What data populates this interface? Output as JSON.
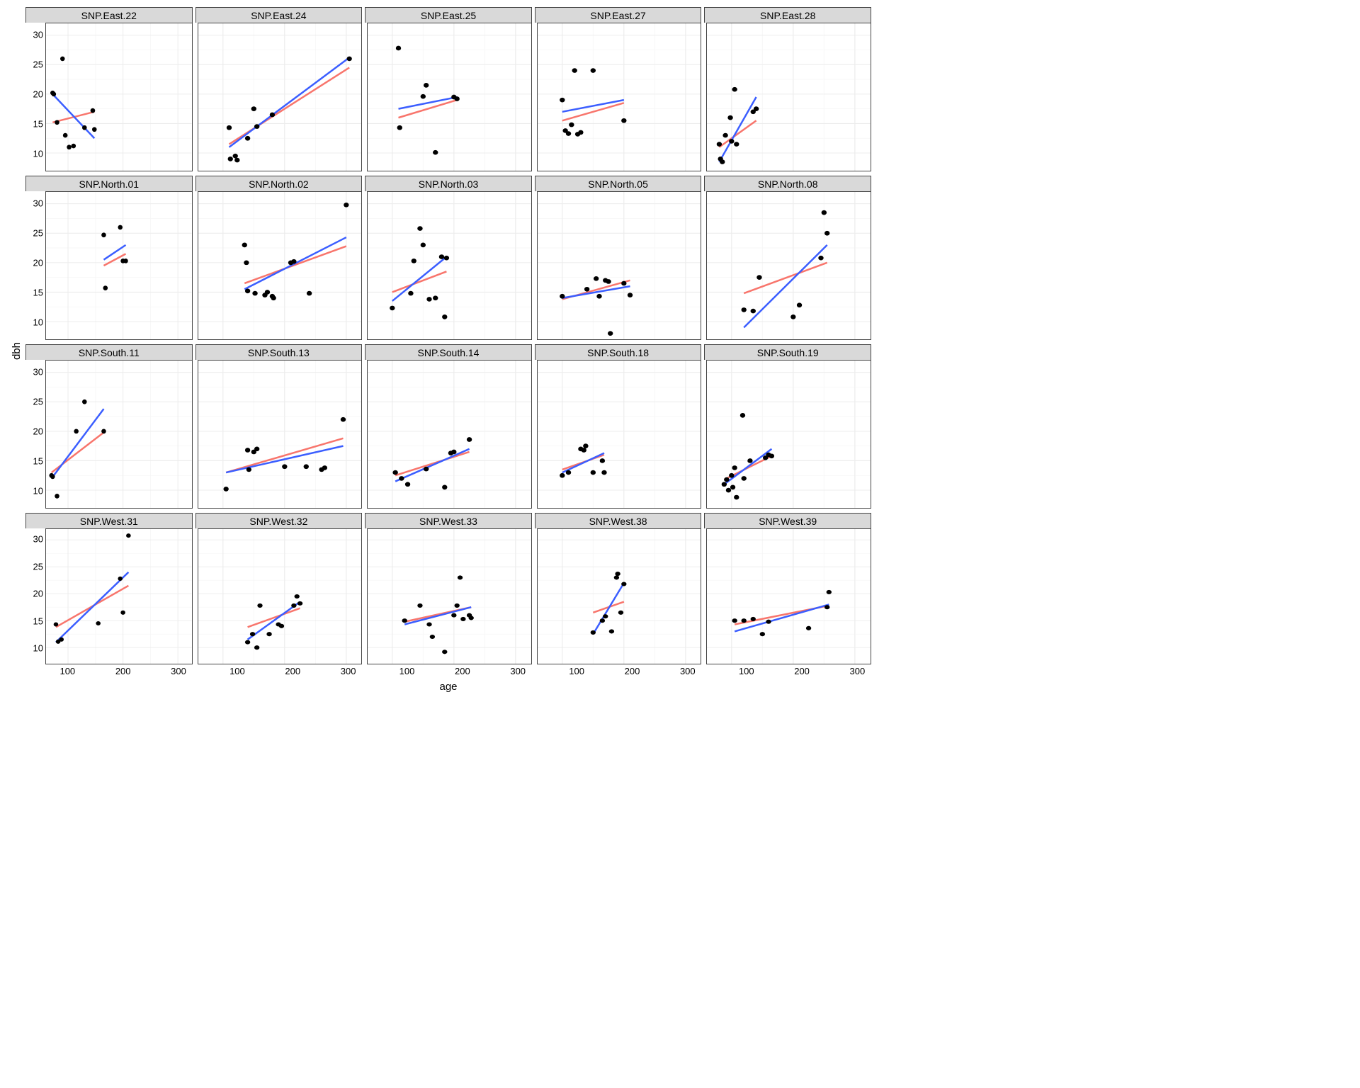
{
  "axis": {
    "x_label": "age",
    "y_label": "dbh"
  },
  "layout": {
    "rows": 4,
    "cols": 5
  },
  "shared": {
    "xlim": [
      60,
      325
    ],
    "ylim": [
      7,
      32
    ],
    "x_ticks": [
      100,
      200,
      300
    ],
    "y_ticks": [
      10,
      15,
      20,
      25,
      30
    ],
    "x_minor": [
      150,
      250
    ],
    "y_minor": [
      12.5,
      17.5,
      22.5,
      27.5
    ]
  },
  "chart_data": [
    {
      "title": "SNP.East.22",
      "type": "scatter",
      "points": [
        {
          "x": 72,
          "y": 20.2
        },
        {
          "x": 74,
          "y": 20.0
        },
        {
          "x": 80,
          "y": 15.2
        },
        {
          "x": 90,
          "y": 26.0
        },
        {
          "x": 95,
          "y": 13.0
        },
        {
          "x": 102,
          "y": 11.0
        },
        {
          "x": 110,
          "y": 11.2
        },
        {
          "x": 130,
          "y": 14.3
        },
        {
          "x": 145,
          "y": 17.2
        },
        {
          "x": 148,
          "y": 14.0
        }
      ],
      "red": {
        "x1": 72,
        "y1": 15.2,
        "x2": 148,
        "y2": 17.0
      },
      "blue": {
        "x1": 72,
        "y1": 20.0,
        "x2": 148,
        "y2": 12.5
      }
    },
    {
      "title": "SNP.East.24",
      "type": "scatter",
      "points": [
        {
          "x": 110,
          "y": 14.3
        },
        {
          "x": 112,
          "y": 9.0
        },
        {
          "x": 120,
          "y": 9.5
        },
        {
          "x": 123,
          "y": 8.8
        },
        {
          "x": 140,
          "y": 12.5
        },
        {
          "x": 150,
          "y": 17.5
        },
        {
          "x": 155,
          "y": 14.5
        },
        {
          "x": 180,
          "y": 16.5
        },
        {
          "x": 305,
          "y": 26.0
        }
      ],
      "red": {
        "x1": 110,
        "y1": 11.5,
        "x2": 305,
        "y2": 24.5
      },
      "blue": {
        "x1": 110,
        "y1": 11.0,
        "x2": 305,
        "y2": 26.2
      }
    },
    {
      "title": "SNP.East.25",
      "type": "scatter",
      "points": [
        {
          "x": 110,
          "y": 27.8
        },
        {
          "x": 112,
          "y": 14.3
        },
        {
          "x": 150,
          "y": 19.6
        },
        {
          "x": 155,
          "y": 21.5
        },
        {
          "x": 170,
          "y": 10.1
        },
        {
          "x": 200,
          "y": 19.5
        },
        {
          "x": 205,
          "y": 19.2
        }
      ],
      "red": {
        "x1": 110,
        "y1": 16.0,
        "x2": 205,
        "y2": 19.0
      },
      "blue": {
        "x1": 110,
        "y1": 17.5,
        "x2": 205,
        "y2": 19.5
      }
    },
    {
      "title": "SNP.East.27",
      "type": "scatter",
      "points": [
        {
          "x": 100,
          "y": 19.0
        },
        {
          "x": 105,
          "y": 13.8
        },
        {
          "x": 110,
          "y": 13.3
        },
        {
          "x": 115,
          "y": 14.8
        },
        {
          "x": 120,
          "y": 24.0
        },
        {
          "x": 125,
          "y": 13.2
        },
        {
          "x": 130,
          "y": 13.5
        },
        {
          "x": 150,
          "y": 24.0
        },
        {
          "x": 200,
          "y": 15.5
        }
      ],
      "red": {
        "x1": 100,
        "y1": 15.5,
        "x2": 200,
        "y2": 18.5
      },
      "blue": {
        "x1": 100,
        "y1": 17.0,
        "x2": 200,
        "y2": 19.0
      }
    },
    {
      "title": "SNP.East.28",
      "type": "scatter",
      "points": [
        {
          "x": 80,
          "y": 11.5
        },
        {
          "x": 82,
          "y": 9.0
        },
        {
          "x": 85,
          "y": 8.5
        },
        {
          "x": 90,
          "y": 13.0
        },
        {
          "x": 98,
          "y": 16.0
        },
        {
          "x": 100,
          "y": 12.0
        },
        {
          "x": 105,
          "y": 20.8
        },
        {
          "x": 108,
          "y": 11.5
        },
        {
          "x": 135,
          "y": 17.0
        },
        {
          "x": 140,
          "y": 17.5
        }
      ],
      "red": {
        "x1": 80,
        "y1": 11.0,
        "x2": 140,
        "y2": 15.5
      },
      "blue": {
        "x1": 80,
        "y1": 8.5,
        "x2": 140,
        "y2": 19.5
      }
    },
    {
      "title": "SNP.North.01",
      "type": "scatter",
      "points": [
        {
          "x": 165,
          "y": 24.7
        },
        {
          "x": 168,
          "y": 15.7
        },
        {
          "x": 195,
          "y": 26.0
        },
        {
          "x": 200,
          "y": 20.3
        },
        {
          "x": 205,
          "y": 20.3
        }
      ],
      "red": {
        "x1": 165,
        "y1": 19.5,
        "x2": 205,
        "y2": 21.5
      },
      "blue": {
        "x1": 165,
        "y1": 20.5,
        "x2": 205,
        "y2": 23.0
      }
    },
    {
      "title": "SNP.North.02",
      "type": "scatter",
      "points": [
        {
          "x": 135,
          "y": 23.0
        },
        {
          "x": 138,
          "y": 20.0
        },
        {
          "x": 140,
          "y": 15.2
        },
        {
          "x": 152,
          "y": 14.8
        },
        {
          "x": 168,
          "y": 14.5
        },
        {
          "x": 172,
          "y": 15.0
        },
        {
          "x": 180,
          "y": 14.3
        },
        {
          "x": 182,
          "y": 14.0
        },
        {
          "x": 210,
          "y": 20.0
        },
        {
          "x": 215,
          "y": 20.2
        },
        {
          "x": 240,
          "y": 14.8
        },
        {
          "x": 300,
          "y": 29.8
        }
      ],
      "red": {
        "x1": 135,
        "y1": 16.5,
        "x2": 300,
        "y2": 22.8
      },
      "blue": {
        "x1": 135,
        "y1": 15.5,
        "x2": 300,
        "y2": 24.3
      }
    },
    {
      "title": "SNP.North.03",
      "type": "scatter",
      "points": [
        {
          "x": 100,
          "y": 12.3
        },
        {
          "x": 130,
          "y": 14.8
        },
        {
          "x": 135,
          "y": 20.3
        },
        {
          "x": 145,
          "y": 25.8
        },
        {
          "x": 150,
          "y": 23.0
        },
        {
          "x": 160,
          "y": 13.8
        },
        {
          "x": 170,
          "y": 14.0
        },
        {
          "x": 180,
          "y": 21.0
        },
        {
          "x": 185,
          "y": 10.8
        },
        {
          "x": 188,
          "y": 20.8
        }
      ],
      "red": {
        "x1": 100,
        "y1": 15.0,
        "x2": 188,
        "y2": 18.5
      },
      "blue": {
        "x1": 100,
        "y1": 13.5,
        "x2": 188,
        "y2": 21.0
      }
    },
    {
      "title": "SNP.North.05",
      "type": "scatter",
      "points": [
        {
          "x": 100,
          "y": 14.3
        },
        {
          "x": 140,
          "y": 15.5
        },
        {
          "x": 155,
          "y": 17.3
        },
        {
          "x": 160,
          "y": 14.3
        },
        {
          "x": 170,
          "y": 17.0
        },
        {
          "x": 175,
          "y": 16.8
        },
        {
          "x": 178,
          "y": 8.0
        },
        {
          "x": 200,
          "y": 16.5
        },
        {
          "x": 210,
          "y": 14.5
        }
      ],
      "red": {
        "x1": 100,
        "y1": 13.8,
        "x2": 210,
        "y2": 17.0
      },
      "blue": {
        "x1": 100,
        "y1": 14.0,
        "x2": 210,
        "y2": 16.0
      }
    },
    {
      "title": "SNP.North.08",
      "type": "scatter",
      "points": [
        {
          "x": 120,
          "y": 12.0
        },
        {
          "x": 135,
          "y": 11.8
        },
        {
          "x": 145,
          "y": 17.5
        },
        {
          "x": 200,
          "y": 10.8
        },
        {
          "x": 210,
          "y": 12.8
        },
        {
          "x": 245,
          "y": 20.8
        },
        {
          "x": 250,
          "y": 28.5
        },
        {
          "x": 255,
          "y": 25.0
        }
      ],
      "red": {
        "x1": 120,
        "y1": 14.8,
        "x2": 255,
        "y2": 20.0
      },
      "blue": {
        "x1": 120,
        "y1": 9.0,
        "x2": 255,
        "y2": 23.0
      }
    },
    {
      "title": "SNP.South.11",
      "type": "scatter",
      "points": [
        {
          "x": 70,
          "y": 12.5
        },
        {
          "x": 72,
          "y": 12.3
        },
        {
          "x": 80,
          "y": 9.0
        },
        {
          "x": 115,
          "y": 20.0
        },
        {
          "x": 130,
          "y": 25.0
        },
        {
          "x": 165,
          "y": 20.0
        }
      ],
      "red": {
        "x1": 70,
        "y1": 13.0,
        "x2": 165,
        "y2": 19.8
      },
      "blue": {
        "x1": 70,
        "y1": 12.0,
        "x2": 165,
        "y2": 23.8
      }
    },
    {
      "title": "SNP.South.13",
      "type": "scatter",
      "points": [
        {
          "x": 105,
          "y": 10.2
        },
        {
          "x": 140,
          "y": 16.8
        },
        {
          "x": 142,
          "y": 13.5
        },
        {
          "x": 150,
          "y": 16.5
        },
        {
          "x": 155,
          "y": 17.0
        },
        {
          "x": 200,
          "y": 14.0
        },
        {
          "x": 235,
          "y": 14.0
        },
        {
          "x": 260,
          "y": 13.5
        },
        {
          "x": 265,
          "y": 13.8
        },
        {
          "x": 295,
          "y": 22.0
        }
      ],
      "red": {
        "x1": 105,
        "y1": 13.0,
        "x2": 295,
        "y2": 18.8
      },
      "blue": {
        "x1": 105,
        "y1": 13.0,
        "x2": 295,
        "y2": 17.5
      }
    },
    {
      "title": "SNP.South.14",
      "type": "scatter",
      "points": [
        {
          "x": 105,
          "y": 13.0
        },
        {
          "x": 115,
          "y": 12.0
        },
        {
          "x": 125,
          "y": 11.0
        },
        {
          "x": 155,
          "y": 13.6
        },
        {
          "x": 185,
          "y": 10.5
        },
        {
          "x": 195,
          "y": 16.3
        },
        {
          "x": 200,
          "y": 16.5
        },
        {
          "x": 225,
          "y": 18.6
        }
      ],
      "red": {
        "x1": 105,
        "y1": 12.5,
        "x2": 225,
        "y2": 16.5
      },
      "blue": {
        "x1": 105,
        "y1": 11.5,
        "x2": 225,
        "y2": 17.0
      }
    },
    {
      "title": "SNP.South.18",
      "type": "scatter",
      "points": [
        {
          "x": 100,
          "y": 12.5
        },
        {
          "x": 110,
          "y": 13.0
        },
        {
          "x": 130,
          "y": 17.0
        },
        {
          "x": 135,
          "y": 16.8
        },
        {
          "x": 138,
          "y": 17.5
        },
        {
          "x": 150,
          "y": 13.0
        },
        {
          "x": 165,
          "y": 15.0
        },
        {
          "x": 168,
          "y": 13.0
        }
      ],
      "red": {
        "x1": 100,
        "y1": 13.5,
        "x2": 168,
        "y2": 16.0
      },
      "blue": {
        "x1": 100,
        "y1": 13.0,
        "x2": 168,
        "y2": 16.3
      }
    },
    {
      "title": "SNP.South.19",
      "type": "scatter",
      "points": [
        {
          "x": 88,
          "y": 11.0
        },
        {
          "x": 92,
          "y": 11.8
        },
        {
          "x": 95,
          "y": 10.0
        },
        {
          "x": 100,
          "y": 12.5
        },
        {
          "x": 102,
          "y": 10.5
        },
        {
          "x": 105,
          "y": 13.8
        },
        {
          "x": 108,
          "y": 8.8
        },
        {
          "x": 118,
          "y": 22.7
        },
        {
          "x": 120,
          "y": 12.0
        },
        {
          "x": 130,
          "y": 15.0
        },
        {
          "x": 155,
          "y": 15.5
        },
        {
          "x": 160,
          "y": 16.0
        },
        {
          "x": 165,
          "y": 15.8
        }
      ],
      "red": {
        "x1": 88,
        "y1": 11.8,
        "x2": 165,
        "y2": 15.8
      },
      "blue": {
        "x1": 88,
        "y1": 11.0,
        "x2": 165,
        "y2": 17.0
      }
    },
    {
      "title": "SNP.West.31",
      "type": "scatter",
      "points": [
        {
          "x": 78,
          "y": 14.3
        },
        {
          "x": 82,
          "y": 11.1
        },
        {
          "x": 88,
          "y": 11.5
        },
        {
          "x": 155,
          "y": 14.5
        },
        {
          "x": 195,
          "y": 22.8
        },
        {
          "x": 200,
          "y": 16.5
        },
        {
          "x": 210,
          "y": 30.8
        }
      ],
      "red": {
        "x1": 78,
        "y1": 13.8,
        "x2": 210,
        "y2": 21.5
      },
      "blue": {
        "x1": 78,
        "y1": 11.0,
        "x2": 210,
        "y2": 24.0
      }
    },
    {
      "title": "SNP.West.32",
      "type": "scatter",
      "points": [
        {
          "x": 140,
          "y": 11.0
        },
        {
          "x": 148,
          "y": 12.5
        },
        {
          "x": 155,
          "y": 10.0
        },
        {
          "x": 160,
          "y": 17.8
        },
        {
          "x": 175,
          "y": 12.5
        },
        {
          "x": 190,
          "y": 14.3
        },
        {
          "x": 195,
          "y": 14.0
        },
        {
          "x": 215,
          "y": 17.8
        },
        {
          "x": 220,
          "y": 19.5
        },
        {
          "x": 225,
          "y": 18.2
        }
      ],
      "red": {
        "x1": 140,
        "y1": 13.8,
        "x2": 225,
        "y2": 17.3
      },
      "blue": {
        "x1": 140,
        "y1": 11.5,
        "x2": 225,
        "y2": 18.5
      }
    },
    {
      "title": "SNP.West.33",
      "type": "scatter",
      "points": [
        {
          "x": 120,
          "y": 15.0
        },
        {
          "x": 145,
          "y": 17.8
        },
        {
          "x": 160,
          "y": 14.3
        },
        {
          "x": 165,
          "y": 12.0
        },
        {
          "x": 185,
          "y": 9.2
        },
        {
          "x": 200,
          "y": 16.0
        },
        {
          "x": 205,
          "y": 17.8
        },
        {
          "x": 210,
          "y": 23.0
        },
        {
          "x": 215,
          "y": 15.3
        },
        {
          "x": 225,
          "y": 16.0
        },
        {
          "x": 228,
          "y": 15.5
        }
      ],
      "red": {
        "x1": 120,
        "y1": 14.8,
        "x2": 228,
        "y2": 17.5
      },
      "blue": {
        "x1": 120,
        "y1": 14.3,
        "x2": 228,
        "y2": 17.5
      }
    },
    {
      "title": "SNP.West.38",
      "type": "scatter",
      "points": [
        {
          "x": 150,
          "y": 12.8
        },
        {
          "x": 165,
          "y": 15.0
        },
        {
          "x": 170,
          "y": 15.8
        },
        {
          "x": 180,
          "y": 13.0
        },
        {
          "x": 188,
          "y": 23.0
        },
        {
          "x": 190,
          "y": 23.7
        },
        {
          "x": 195,
          "y": 16.5
        },
        {
          "x": 200,
          "y": 21.8
        }
      ],
      "red": {
        "x1": 150,
        "y1": 16.5,
        "x2": 200,
        "y2": 18.5
      },
      "blue": {
        "x1": 150,
        "y1": 12.5,
        "x2": 200,
        "y2": 22.0
      }
    },
    {
      "title": "SNP.West.39",
      "type": "scatter",
      "points": [
        {
          "x": 105,
          "y": 15.0
        },
        {
          "x": 120,
          "y": 15.0
        },
        {
          "x": 135,
          "y": 15.3
        },
        {
          "x": 150,
          "y": 12.5
        },
        {
          "x": 160,
          "y": 14.8
        },
        {
          "x": 225,
          "y": 13.6
        },
        {
          "x": 255,
          "y": 17.5
        },
        {
          "x": 258,
          "y": 20.3
        }
      ],
      "red": {
        "x1": 105,
        "y1": 14.3,
        "x2": 258,
        "y2": 17.8
      },
      "blue": {
        "x1": 105,
        "y1": 13.0,
        "x2": 258,
        "y2": 18.0
      }
    }
  ]
}
